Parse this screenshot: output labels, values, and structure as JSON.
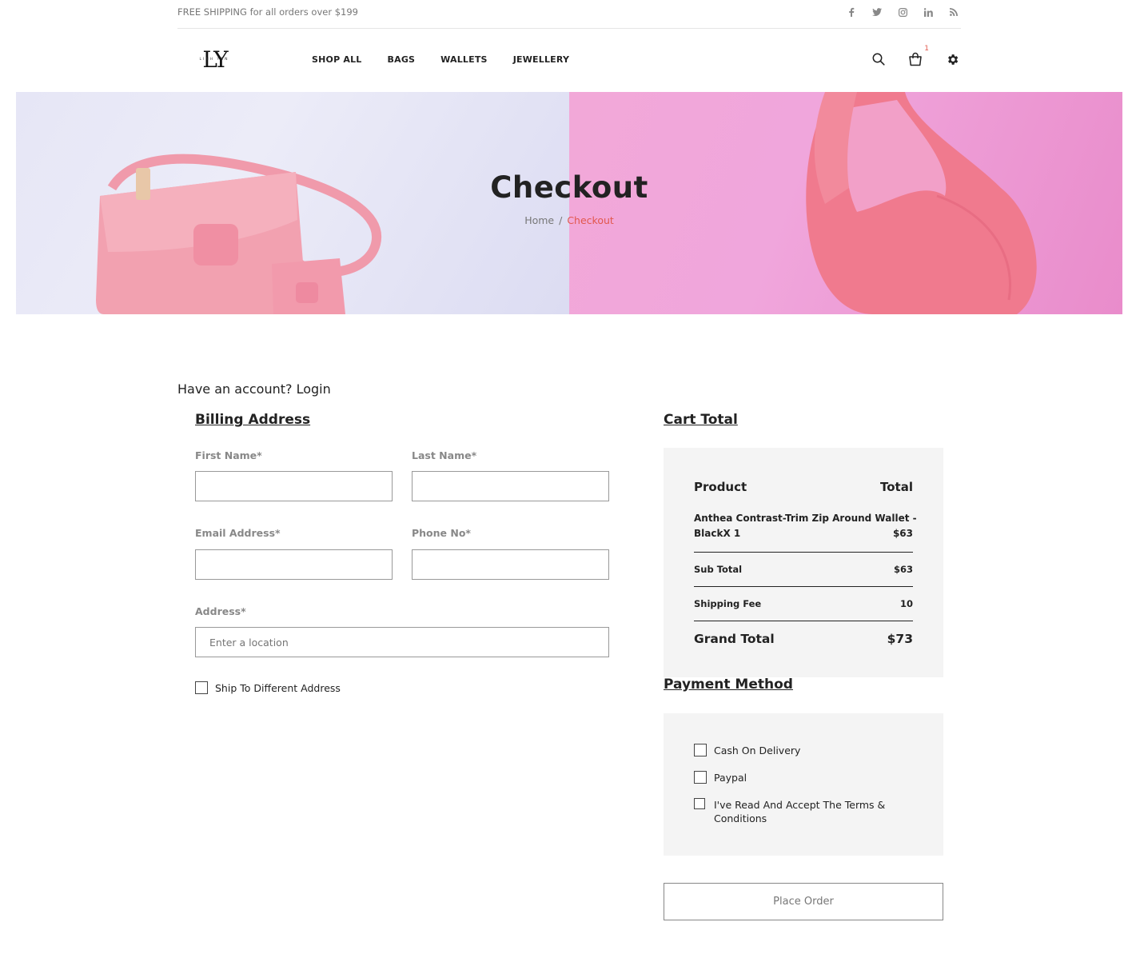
{
  "topbar": {
    "shipping_text": "FREE SHIPPING for all orders over $199",
    "social": [
      "facebook-icon",
      "twitter-icon",
      "instagram-icon",
      "linkedin-icon",
      "rss-icon"
    ]
  },
  "header": {
    "logo_mark": "LY",
    "logo_small": "LINH YEN",
    "nav": [
      "SHOP ALL",
      "BAGS",
      "WALLETS",
      "JEWELLERY"
    ],
    "cart_count": "1"
  },
  "hero": {
    "title": "Checkout",
    "breadcrumb_home": "Home",
    "breadcrumb_sep": "/",
    "breadcrumb_current": "Checkout"
  },
  "account": {
    "prompt": "Have an account? Login"
  },
  "billing": {
    "title": "Billing Address",
    "first_name_label": "First Name*",
    "last_name_label": "Last Name*",
    "email_label": "Email Address*",
    "phone_label": "Phone No*",
    "address_label": "Address*",
    "address_placeholder": "Enter a location",
    "ship_diff_label": "Ship To Different Address"
  },
  "cart": {
    "title": "Cart Total",
    "col_product": "Product",
    "col_total": "Total",
    "item_name_line1": "Anthea Contrast-Trim Zip Around Wallet -",
    "item_name_line2": "BlackX 1",
    "item_price": "$63",
    "subtotal_label": "Sub Total",
    "subtotal_value": "$63",
    "shipping_label": "Shipping Fee",
    "shipping_value": "10",
    "grand_label": "Grand Total",
    "grand_value": "$73"
  },
  "payment": {
    "title": "Payment Method",
    "cod_label": "Cash On Delivery",
    "paypal_label": "Paypal",
    "terms_line1": "I've Read And Accept The Terms &",
    "terms_line2": "Conditions",
    "place_order": "Place Order"
  },
  "colors": {
    "accent": "#e2574c",
    "panel_bg": "#f4f4f4"
  }
}
